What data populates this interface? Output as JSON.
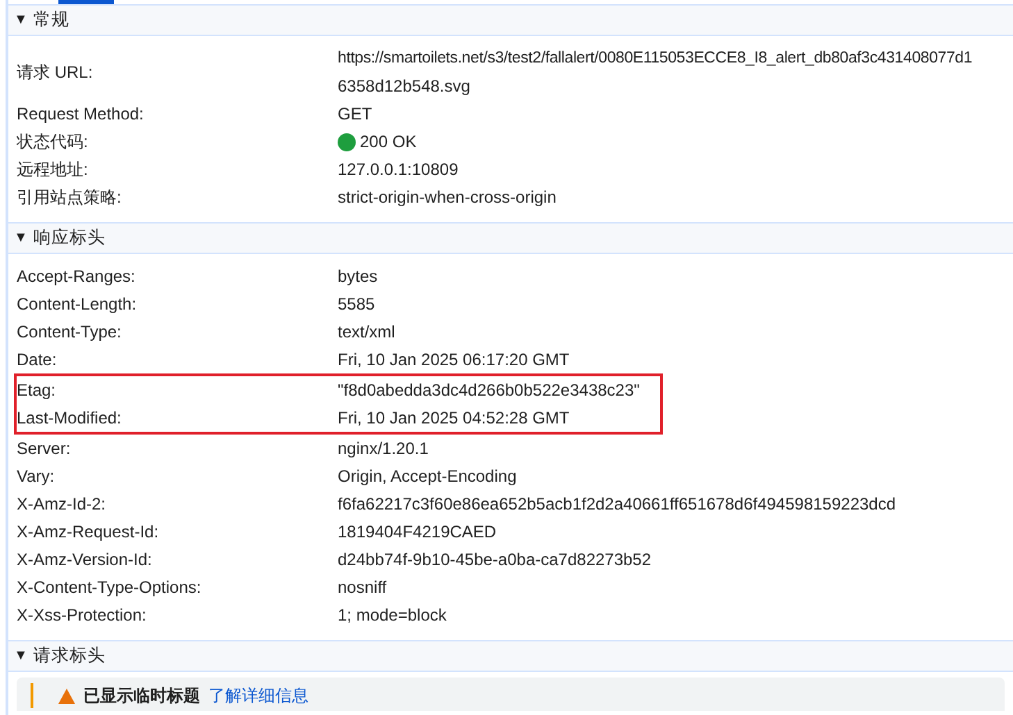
{
  "sections": [
    {
      "toggle": "▼",
      "title": "常规",
      "expanded": true,
      "rows": [
        {
          "name": "请求 URL:",
          "value_lines": [
            "https://smartoilets.net/s3/test2/fallalert/0080E115053ECCE8_I8_alert_db80af3c431408077d1",
            "6358d12b548.svg"
          ],
          "highlighted": false
        },
        {
          "name": "Request Method:",
          "value_lines": [
            "GET"
          ],
          "highlighted": false
        },
        {
          "name": "状态代码:",
          "value_lines": [
            "200 OK"
          ],
          "color": "#1e9e3e",
          "highlighted": false
        },
        {
          "name": "远程地址:",
          "value_lines": [
            "127.0.0.1:10809"
          ],
          "highlighted": false
        },
        {
          "name": "引用站点策略:",
          "value_lines": [
            "strict-origin-when-cross-origin"
          ],
          "highlighted": false
        }
      ]
    },
    {
      "toggle": "▼",
      "title": "响应标头",
      "expanded": true,
      "rows": [
        {
          "name": "Accept-Ranges:",
          "value_lines": [
            "bytes"
          ],
          "highlighted": false
        },
        {
          "name": "Content-Length:",
          "value_lines": [
            "5585"
          ],
          "highlighted": false
        },
        {
          "name": "Content-Type:",
          "value_lines": [
            "text/xml"
          ],
          "highlighted": false
        },
        {
          "name": "Date:",
          "value_lines": [
            "Fri, 10 Jan 2025 06:17:20 GMT"
          ],
          "highlighted": false
        },
        {
          "name": "Etag:",
          "value_lines": [
            "\"f8d0abedda3dc4d266b0b522e3438c23\""
          ],
          "highlighted": true
        },
        {
          "name": "Last-Modified:",
          "value_lines": [
            "Fri, 10 Jan 2025 04:52:28 GMT"
          ],
          "highlighted": true
        },
        {
          "name": "Server:",
          "value_lines": [
            "nginx/1.20.1"
          ],
          "highlighted": false
        },
        {
          "name": "Vary:",
          "value_lines": [
            "Origin, Accept-Encoding"
          ],
          "highlighted": false
        },
        {
          "name": "X-Amz-Id-2:",
          "value_lines": [
            "f6fa62217c3f60e86ea652b5acb1f2d2a40661ff651678d6f494598159223dcd"
          ],
          "highlighted": false
        },
        {
          "name": "X-Amz-Request-Id:",
          "value_lines": [
            "1819404F4219CAED"
          ],
          "highlighted": false
        },
        {
          "name": "X-Amz-Version-Id:",
          "value_lines": [
            "d24bb74f-9b10-45be-a0ba-ca7d82273b52"
          ],
          "highlighted": false
        },
        {
          "name": "X-Content-Type-Options:",
          "value_lines": [
            "nosniff"
          ],
          "highlighted": false
        },
        {
          "name": "X-Xss-Protection:",
          "value_lines": [
            "1; mode=block"
          ],
          "highlighted": false
        }
      ]
    },
    {
      "toggle": "▼",
      "title": "请求标头",
      "expanded": true,
      "notice": {
        "text": "已显示临时标题",
        "link": "了解详细信息"
      }
    }
  ]
}
